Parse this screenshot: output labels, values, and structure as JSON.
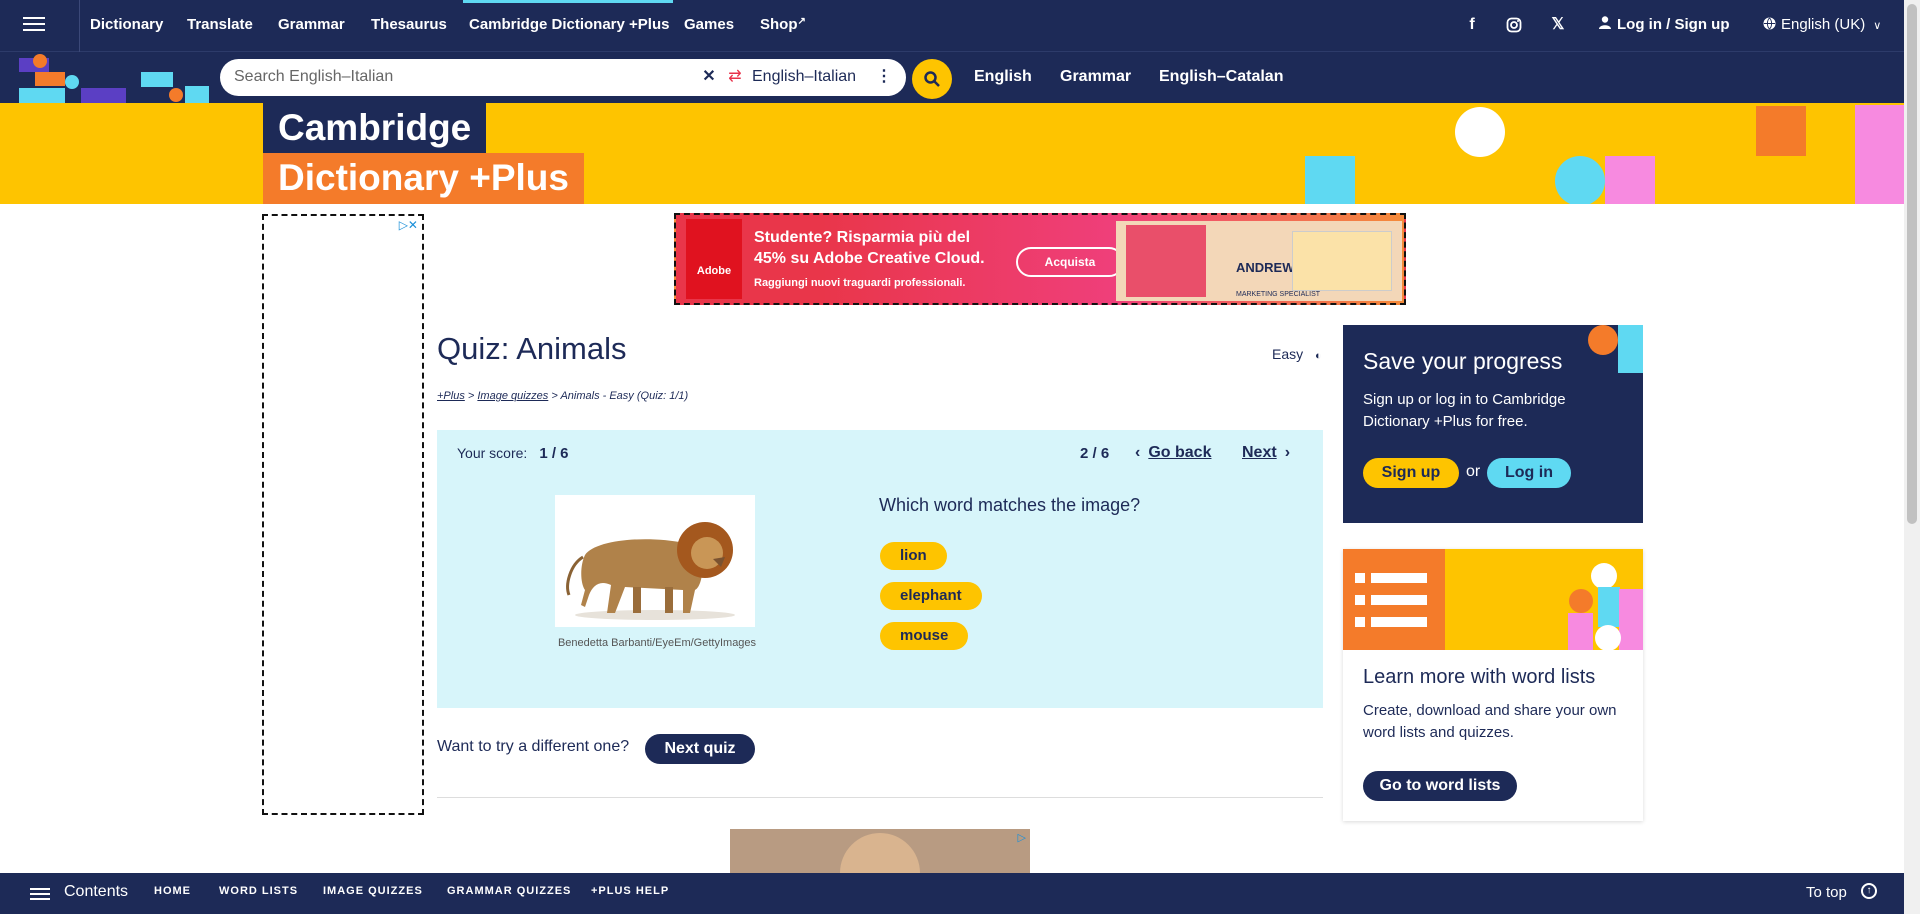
{
  "topnav": {
    "links": [
      "Dictionary",
      "Translate",
      "Grammar",
      "Thesaurus",
      "Cambridge Dictionary +Plus",
      "Games",
      "Shop"
    ],
    "login": "Log in / Sign up",
    "language": "English (UK)"
  },
  "search": {
    "placeholder": "Search English–Italian",
    "dictionary": "English–Italian",
    "quick_links": [
      "English",
      "Grammar",
      "English–Catalan"
    ]
  },
  "banner": {
    "title_line1": "Cambridge",
    "title_line2": "Dictionary +Plus"
  },
  "ad_top": {
    "brand": "Adobe",
    "headline": "Studente? Risparmia più del 45% su Adobe Creative Cloud.",
    "sub": "Raggiungi nuovi traguardi professionali.",
    "cta": "Acquista",
    "person_name": "ANDREW LYONS",
    "person_role": "MARKETING SPECIALIST"
  },
  "quiz": {
    "title": "Quiz: Animals",
    "difficulty": "Easy",
    "breadcrumb": {
      "plus": "+Plus",
      "image_quizzes": "Image quizzes",
      "current": "> Animals - Easy (Quiz: 1/1)"
    },
    "score_label": "Your score:",
    "score": "1 / 6",
    "position": "2 / 6",
    "go_back": "Go back",
    "next": "Next",
    "credit": "Benedetta Barbanti/EyeEm/GettyImages",
    "question": "Which word matches the image?",
    "options": [
      "lion",
      "elephant",
      "mouse"
    ],
    "try_different": "Want to try a different one?",
    "next_quiz": "Next quiz"
  },
  "sidebar": {
    "progress": {
      "title": "Save your progress",
      "text": "Sign up or log in to Cambridge Dictionary +Plus for free.",
      "signup": "Sign up",
      "or": "or",
      "login": "Log in"
    },
    "wordlists": {
      "title": "Learn more with word lists",
      "text": "Create, download and share your own word lists and quizzes.",
      "button": "Go to word lists"
    }
  },
  "bottombar": {
    "contents": "Contents",
    "links": [
      "HOME",
      "WORD LISTS",
      "IMAGE QUIZZES",
      "GRAMMAR QUIZZES",
      "+PLUS HELP"
    ],
    "to_top": "To top"
  },
  "colors": {
    "navy": "#1d2a57",
    "yellow": "#fec400",
    "orange": "#f47b2a",
    "cyan": "#5fd9f2",
    "pink": "#f78ae0",
    "light_cyan_bg": "#d7f5fa"
  }
}
